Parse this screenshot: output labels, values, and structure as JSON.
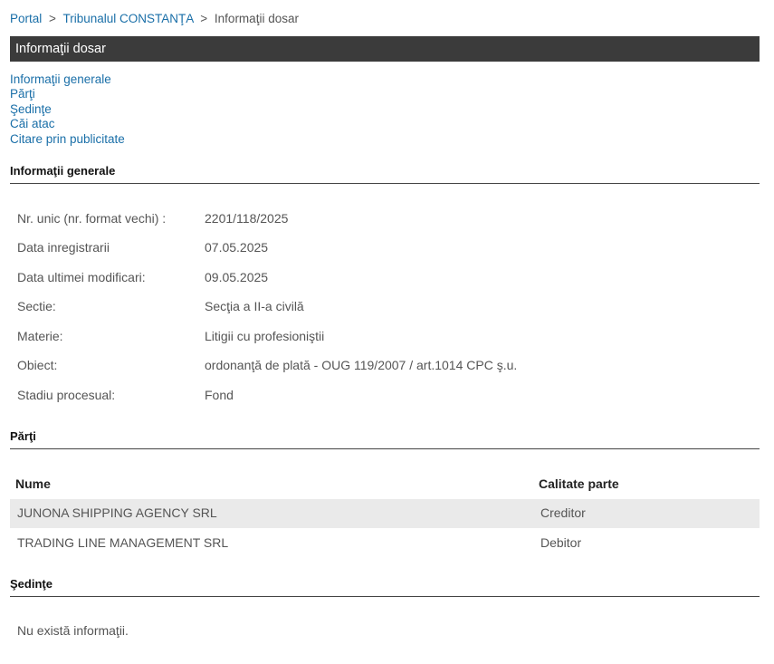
{
  "breadcrumb": {
    "home": "Portal",
    "court": "Tribunalul CONSTANŢA",
    "current": "Informaţii dosar",
    "separator": ">"
  },
  "page_title": "Informaţii dosar",
  "nav": {
    "items": [
      {
        "label": "Informaţii generale"
      },
      {
        "label": "Părţi"
      },
      {
        "label": "Şedinţe"
      },
      {
        "label": "Căi atac"
      },
      {
        "label": "Citare prin publicitate"
      }
    ]
  },
  "general": {
    "heading": "Informaţii generale",
    "rows": [
      {
        "label": "Nr. unic (nr. format vechi) :",
        "value": "2201/118/2025"
      },
      {
        "label": "Data inregistrarii",
        "value": "07.05.2025"
      },
      {
        "label": "Data ultimei modificari:",
        "value": "09.05.2025"
      },
      {
        "label": "Sectie:",
        "value": "Secţia a II-a civilă"
      },
      {
        "label": "Materie:",
        "value": "Litigii cu profesioniştii"
      },
      {
        "label": "Obiect:",
        "value": "ordonanţă de plată - OUG 119/2007 / art.1014 CPC ş.u."
      },
      {
        "label": "Stadiu procesual:",
        "value": "Fond"
      }
    ]
  },
  "parties": {
    "heading": "Părţi",
    "columns": {
      "name": "Nume",
      "role": "Calitate parte"
    },
    "rows": [
      {
        "name": "JUNONA SHIPPING AGENCY SRL",
        "role": "Creditor"
      },
      {
        "name": "TRADING LINE MANAGEMENT SRL",
        "role": "Debitor"
      }
    ]
  },
  "hearings": {
    "heading": "Şedinţe",
    "empty_message": "Nu există informaţii."
  },
  "colors": {
    "link": "#1a6fa8",
    "title_bar": "#3b3b3b",
    "alt_row": "#eaeaea"
  }
}
